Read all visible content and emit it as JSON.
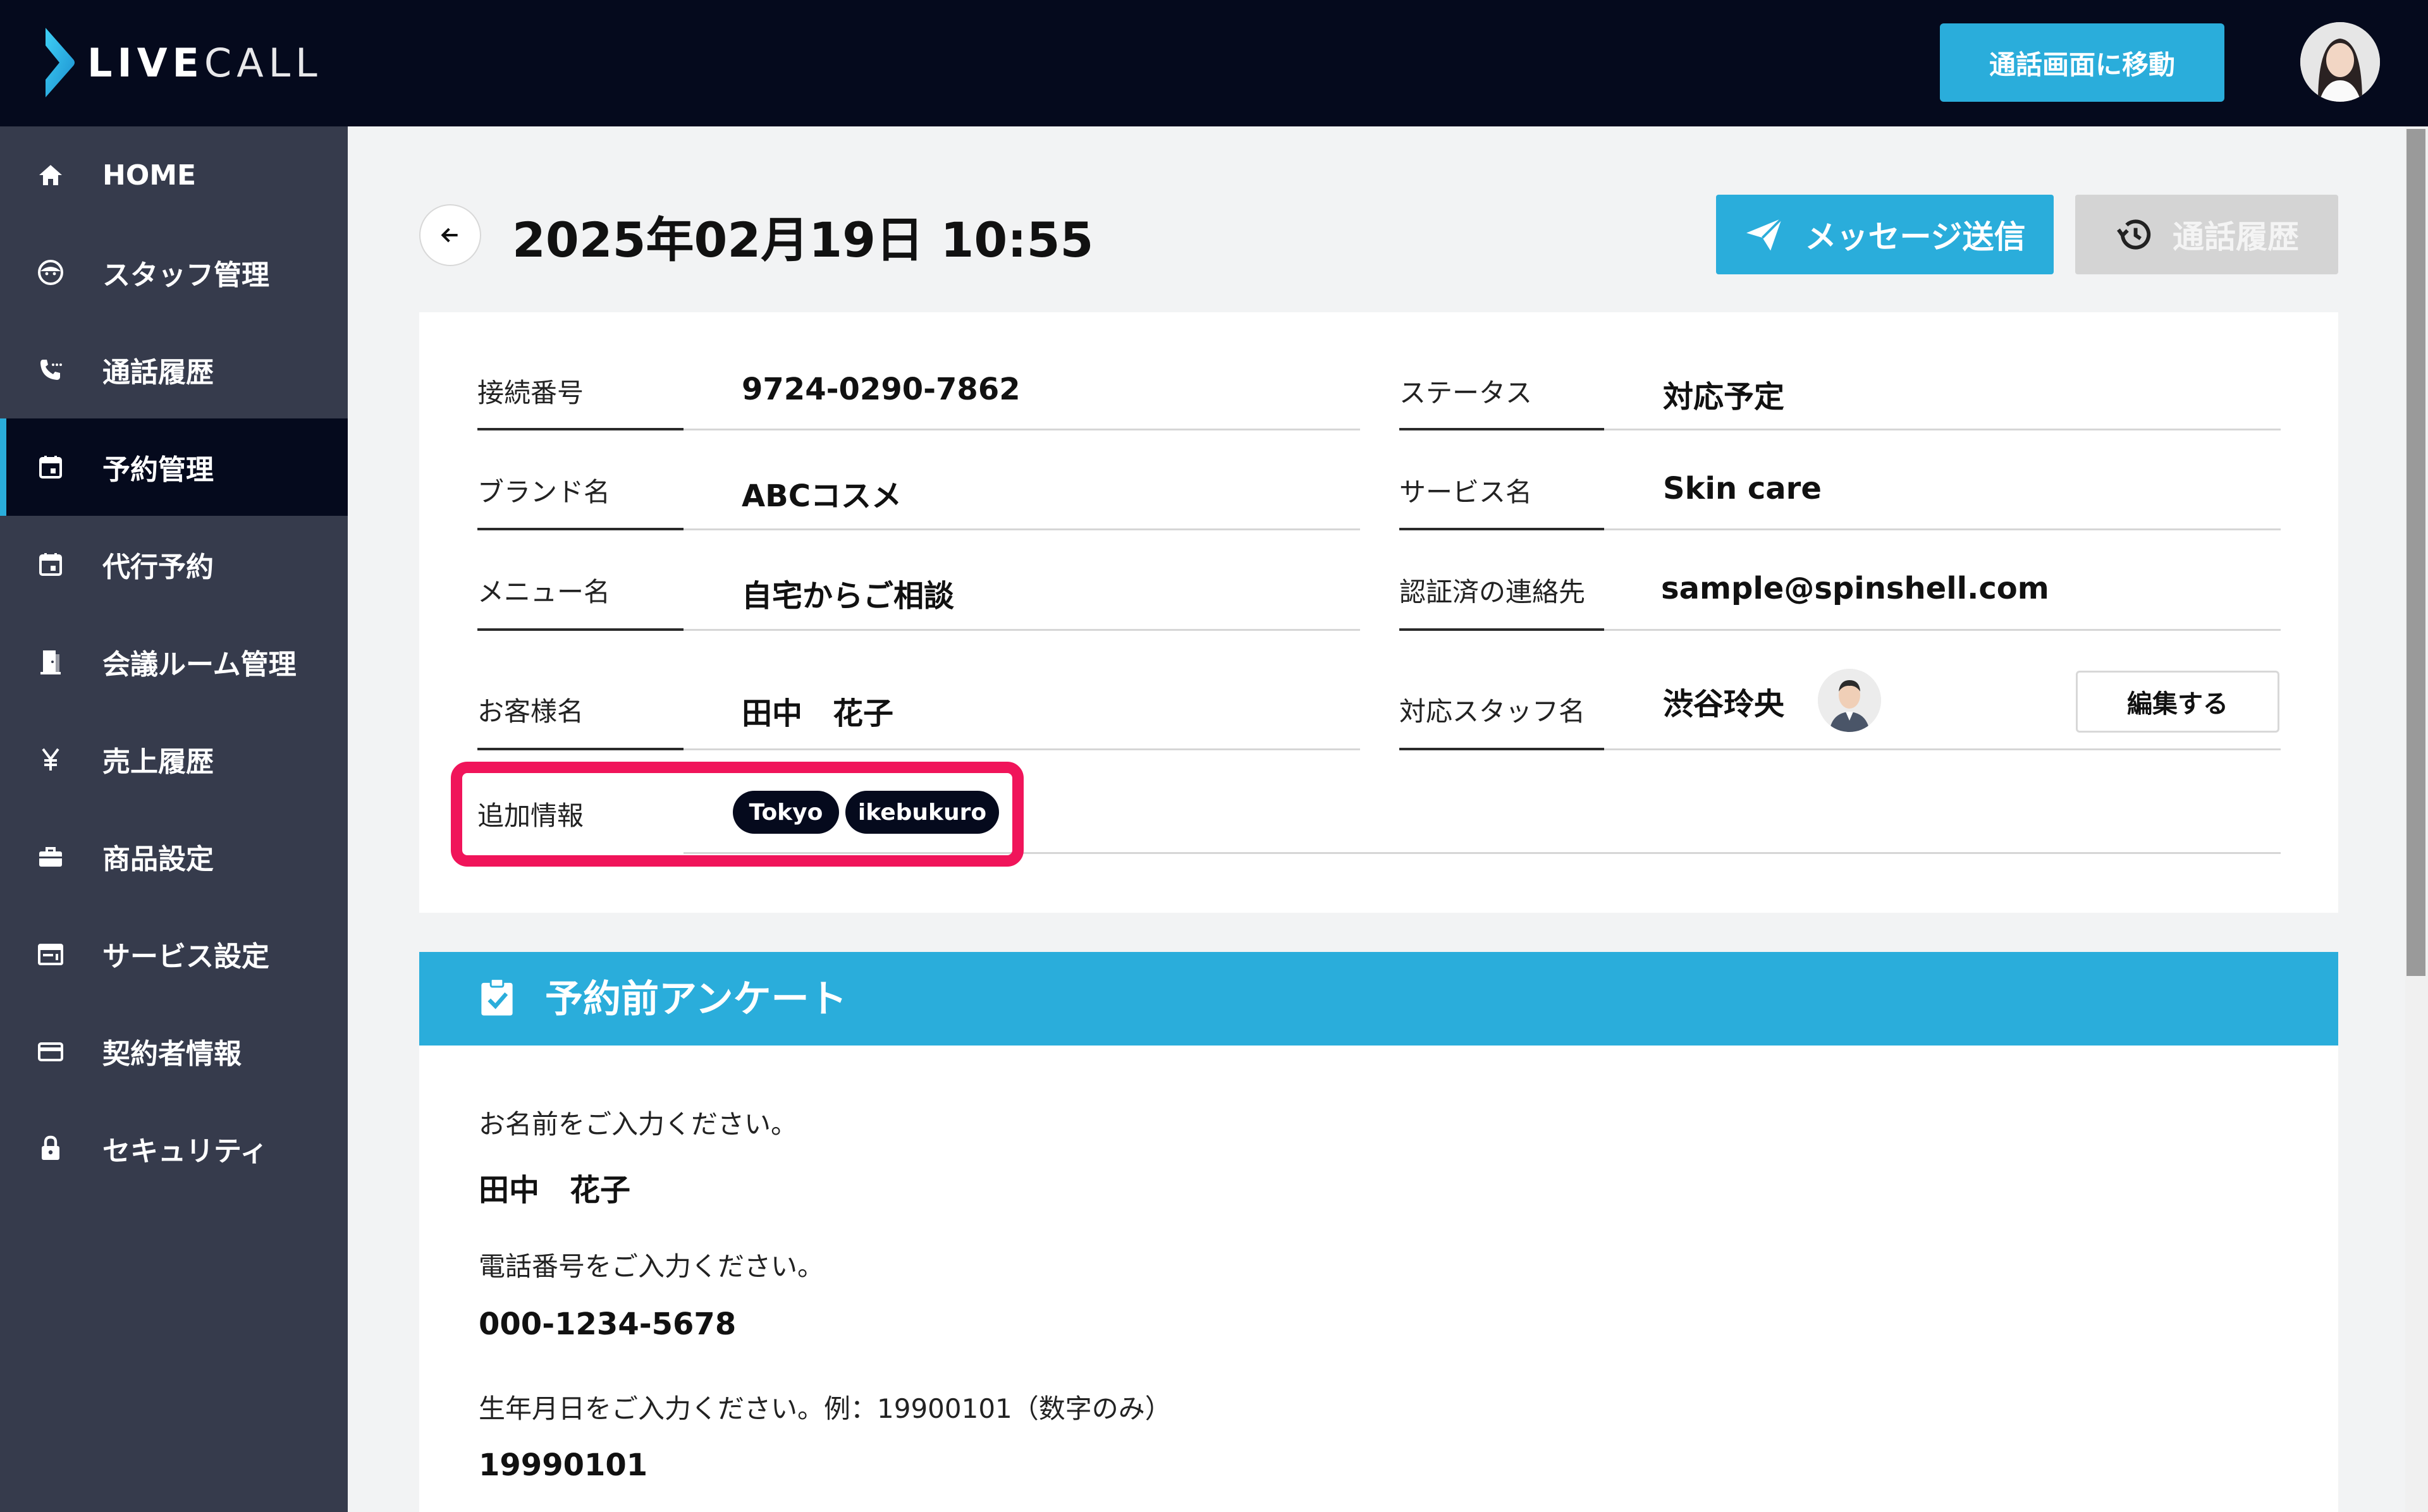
{
  "app": {
    "logo_primary": "LIVE",
    "logo_secondary": "CALL",
    "goto_call_button": "通話画面に移動",
    "brand_color": "#2aaddb",
    "dark_color": "#050a1d",
    "highlight_color": "#f0145a"
  },
  "sidebar": {
    "items": [
      {
        "label": "HOME",
        "icon": "home-icon",
        "active": false
      },
      {
        "label": "スタッフ管理",
        "icon": "staff-face-icon",
        "active": false
      },
      {
        "label": "通話履歴",
        "icon": "phone-call-icon",
        "active": false
      },
      {
        "label": "予約管理",
        "icon": "calendar-icon",
        "active": true
      },
      {
        "label": "代行予約",
        "icon": "calendar-icon",
        "active": false
      },
      {
        "label": "会議ルーム管理",
        "icon": "door-icon",
        "active": false
      },
      {
        "label": "売上履歴",
        "icon": "yen-icon",
        "active": false
      },
      {
        "label": "商品設定",
        "icon": "briefcase-icon",
        "active": false
      },
      {
        "label": "サービス設定",
        "icon": "service-card-icon",
        "active": false
      },
      {
        "label": "契約者情報",
        "icon": "credit-card-icon",
        "active": false
      },
      {
        "label": "セキュリティ",
        "icon": "lock-icon",
        "active": false
      }
    ]
  },
  "header": {
    "title": "2025年02月19日 10:55",
    "send_message_button": "メッセージ送信",
    "call_history_button": "通話履歴"
  },
  "details": {
    "connection_number_label": "接続番号",
    "connection_number": "9724-0290-7862",
    "status_label": "ステータス",
    "status": "対応予定",
    "brand_label": "ブランド名",
    "brand": "ABCコスメ",
    "service_label": "サービス名",
    "service": "Skin care",
    "menu_label": "メニュー名",
    "menu": "自宅からご相談",
    "verified_contact_label": "認証済の連絡先",
    "verified_contact": "sample@spinshell.com",
    "customer_label": "お客様名",
    "customer": "田中　花子",
    "staff_label": "対応スタッフ名",
    "staff": "渋谷玲央",
    "edit_button": "編集する",
    "additional_label": "追加情報",
    "tags": [
      "Tokyo",
      "ikebukuro"
    ]
  },
  "survey": {
    "title": "予約前アンケート",
    "questions": [
      {
        "q": "お名前をご入力ください。",
        "a": "田中　花子"
      },
      {
        "q": "電話番号をご入力ください。",
        "a": "000-1234-5678"
      },
      {
        "q": "生年月日をご入力ください。例：19900101（数字のみ）",
        "a": "19990101"
      }
    ]
  }
}
